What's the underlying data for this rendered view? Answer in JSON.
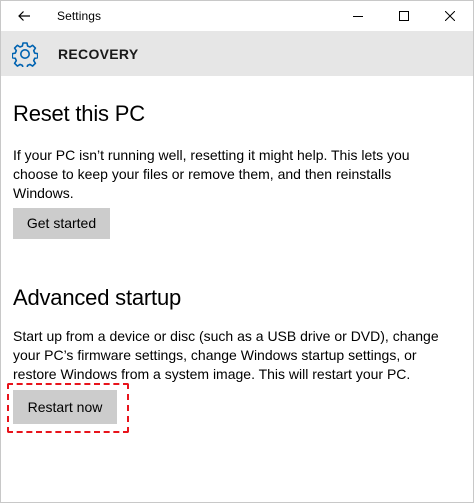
{
  "window": {
    "title": "Settings",
    "icons": {
      "back": "back-arrow-icon",
      "minimize": "minimize-icon",
      "maximize": "maximize-icon",
      "close": "close-icon"
    }
  },
  "header": {
    "icon": "gear-icon",
    "title": "RECOVERY"
  },
  "reset": {
    "title": "Reset this PC",
    "description": "If your PC isn’t running well, resetting it might help. This lets you choose to keep your files or remove them, and then reinstalls Windows.",
    "button_label": "Get started"
  },
  "advanced": {
    "title": "Advanced startup",
    "description": "Start up from a device or disc (such as a USB drive or DVD), change your PC’s firmware settings, change Windows startup settings, or restore Windows from a system image. This will restart your PC.",
    "button_label": "Restart now"
  },
  "colors": {
    "header_band": "#e6e6e6",
    "button_bg": "#cccccc",
    "accent": "#0063b1",
    "highlight": "#e8131b"
  }
}
